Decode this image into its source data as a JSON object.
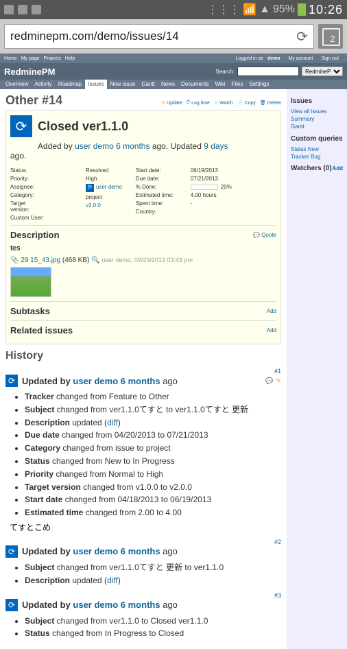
{
  "status_bar": {
    "signal": "95%",
    "time": "10:26"
  },
  "browser": {
    "url": "redminepm.com/demo/issues/14",
    "tab_count": "2"
  },
  "top_nav": {
    "home": "Home",
    "my_page": "My page",
    "projects": "Projects",
    "help": "Help",
    "logged": "Logged in as",
    "user": "demo",
    "account": "My account",
    "signout": "Sign out"
  },
  "app": {
    "title": "RedminePM",
    "search_label": "Search:",
    "project": "RedminePM"
  },
  "tabs": [
    "Overview",
    "Activity",
    "Roadmap",
    "Issues",
    "New issue",
    "Gantt",
    "News",
    "Documents",
    "Wiki",
    "Files",
    "Settings"
  ],
  "issue": {
    "id": "Other #14",
    "actions": {
      "update": "Update",
      "log": "Log time",
      "watch": "Watch",
      "copy": "Copy",
      "delete": "Delete"
    },
    "subject": "Closed ver1.1.0",
    "added_by": "Added by",
    "author": "user demo",
    "author_time": "6 months",
    "ago": "ago. Updated",
    "updated": "9 days",
    "ago2": "ago.",
    "attrs": {
      "status_l": "Status:",
      "status_v": "Resolved",
      "priority_l": "Priority:",
      "priority_v": "High",
      "assignee_l": "Assignee:",
      "assignee_v": "user demo",
      "category_l": "Category:",
      "category_v": "project",
      "target_l": "Target version:",
      "target_v": "v2.0.0",
      "custom_l": "Custom User:",
      "custom_v": "",
      "start_l": "Start date:",
      "start_v": "06/19/2013",
      "due_l": "Due date:",
      "due_v": "07/21/2013",
      "done_l": "% Done:",
      "done_pct": 20,
      "done_v": "20%",
      "est_l": "Estimated time:",
      "est_v": "4.00 hours",
      "spent_l": "Spent time:",
      "spent_v": "-",
      "country_l": "Country:",
      "country_v": ""
    },
    "desc_title": "Description",
    "quote": "Quote",
    "desc_body": "tes",
    "attach": {
      "name": "29 15_43.jpg",
      "size": "(468 KB)",
      "meta": "user demo, 09/29/2013 03:43 pm"
    },
    "subtasks": "Subtasks",
    "related": "Related issues",
    "add": "Add"
  },
  "history": {
    "title": "History",
    "entries": [
      {
        "num": "#1",
        "by": "Updated by",
        "author": "user demo",
        "time": "6 months",
        "ago": "ago",
        "changes": [
          {
            "f": "Tracker",
            "t": "changed from Feature to Other"
          },
          {
            "f": "Subject",
            "t": "changed from ver1.1.0てすと to ver1.1.0てすと 更新"
          },
          {
            "f": "Description",
            "t": "updated (",
            "link": "diff",
            "tail": ")"
          },
          {
            "f": "Due date",
            "t": "changed from 04/20/2013 to 07/21/2013"
          },
          {
            "f": "Category",
            "t": "changed from issue to project"
          },
          {
            "f": "Status",
            "t": "changed from New to In Progress"
          },
          {
            "f": "Priority",
            "t": "changed from Normal to High"
          },
          {
            "f": "Target version",
            "t": "changed from v1.0.0 to v2.0.0"
          },
          {
            "f": "Start date",
            "t": "changed from 04/18/2013 to 06/19/2013"
          },
          {
            "f": "Estimated time",
            "t": "changed from 2.00 to 4.00"
          }
        ],
        "note": "てすとこめ",
        "editable": true
      },
      {
        "num": "#2",
        "by": "Updated by",
        "author": "user demo",
        "time": "6 months",
        "ago": "ago",
        "changes": [
          {
            "f": "Subject",
            "t": "changed from ver1.1.0てすと 更新 to ver1.1.0"
          },
          {
            "f": "Description",
            "t": "updated (",
            "link": "diff",
            "tail": ")"
          }
        ]
      },
      {
        "num": "#3",
        "by": "Updated by",
        "author": "user demo",
        "time": "6 months",
        "ago": "ago",
        "changes": [
          {
            "f": "Subject",
            "t": "changed from ver1.1.0 to Closed ver1.1.0"
          },
          {
            "f": "Status",
            "t": "changed from In Progress to Closed"
          }
        ]
      }
    ]
  },
  "sidebar": {
    "issues_h": "Issues",
    "view_all": "View all issues",
    "summary": "Summary",
    "gantt": "Gantt",
    "queries_h": "Custom queries",
    "q1": "Status New",
    "q2": "Tracker Bug",
    "watchers_h": "Watchers (0)",
    "add": "Add"
  }
}
